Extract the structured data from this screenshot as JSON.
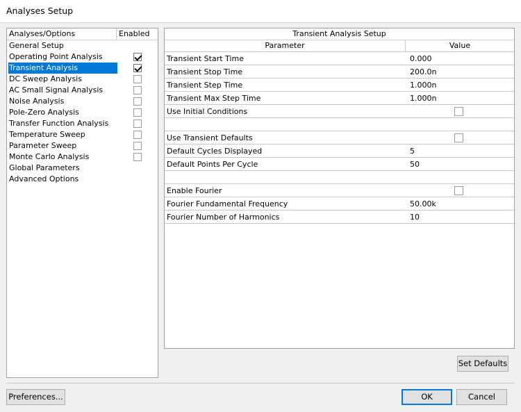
{
  "window": {
    "title": "Analyses Setup"
  },
  "left_panel": {
    "header_col1": "Analyses/Options",
    "header_col2": "Enabled",
    "items": [
      {
        "label": "General Setup",
        "checkbox": null
      },
      {
        "label": "Operating Point Analysis",
        "checkbox": true
      },
      {
        "label": "Transient Analysis",
        "checkbox": true,
        "selected": true
      },
      {
        "label": "DC Sweep Analysis",
        "checkbox": false
      },
      {
        "label": "AC Small Signal Analysis",
        "checkbox": false
      },
      {
        "label": "Noise Analysis",
        "checkbox": false
      },
      {
        "label": "Pole-Zero Analysis",
        "checkbox": false
      },
      {
        "label": "Transfer Function Analysis",
        "checkbox": false
      },
      {
        "label": "Temperature Sweep",
        "checkbox": false
      },
      {
        "label": "Parameter Sweep",
        "checkbox": false
      },
      {
        "label": "Monte Carlo Analysis",
        "checkbox": false
      },
      {
        "label": "Global Parameters",
        "checkbox": null
      },
      {
        "label": "Advanced Options",
        "checkbox": null
      }
    ]
  },
  "right_panel": {
    "title": "Transient Analysis Setup",
    "col_parameter": "Parameter",
    "col_value": "Value",
    "rows": [
      {
        "param": "Transient Start Time",
        "value": "0.000",
        "type": "text"
      },
      {
        "param": "Transient Stop Time",
        "value": "200.0n",
        "type": "text"
      },
      {
        "param": "Transient Step Time",
        "value": "1.000n",
        "type": "text"
      },
      {
        "param": "Transient Max Step Time",
        "value": "1.000n",
        "type": "text"
      },
      {
        "param": "Use Initial Conditions",
        "value": false,
        "type": "checkbox"
      },
      {
        "param": "",
        "value": "",
        "type": "blank"
      },
      {
        "param": "Use Transient Defaults",
        "value": false,
        "type": "checkbox"
      },
      {
        "param": "Default Cycles Displayed",
        "value": "5",
        "type": "text"
      },
      {
        "param": "Default Points Per Cycle",
        "value": "50",
        "type": "text"
      },
      {
        "param": "",
        "value": "",
        "type": "blank"
      },
      {
        "param": "Enable Fourier",
        "value": false,
        "type": "checkbox"
      },
      {
        "param": "Fourier Fundamental Frequency",
        "value": "50.00k",
        "type": "text"
      },
      {
        "param": "Fourier Number of Harmonics",
        "value": "10",
        "type": "text"
      }
    ]
  },
  "buttons": {
    "set_defaults": "Set Defaults",
    "preferences": "Preferences...",
    "ok": "OK",
    "cancel": "Cancel"
  },
  "colors": {
    "selection": "#0078d7",
    "dialog_bg": "#f0f0f0",
    "default_button_border": "#0078d7"
  }
}
